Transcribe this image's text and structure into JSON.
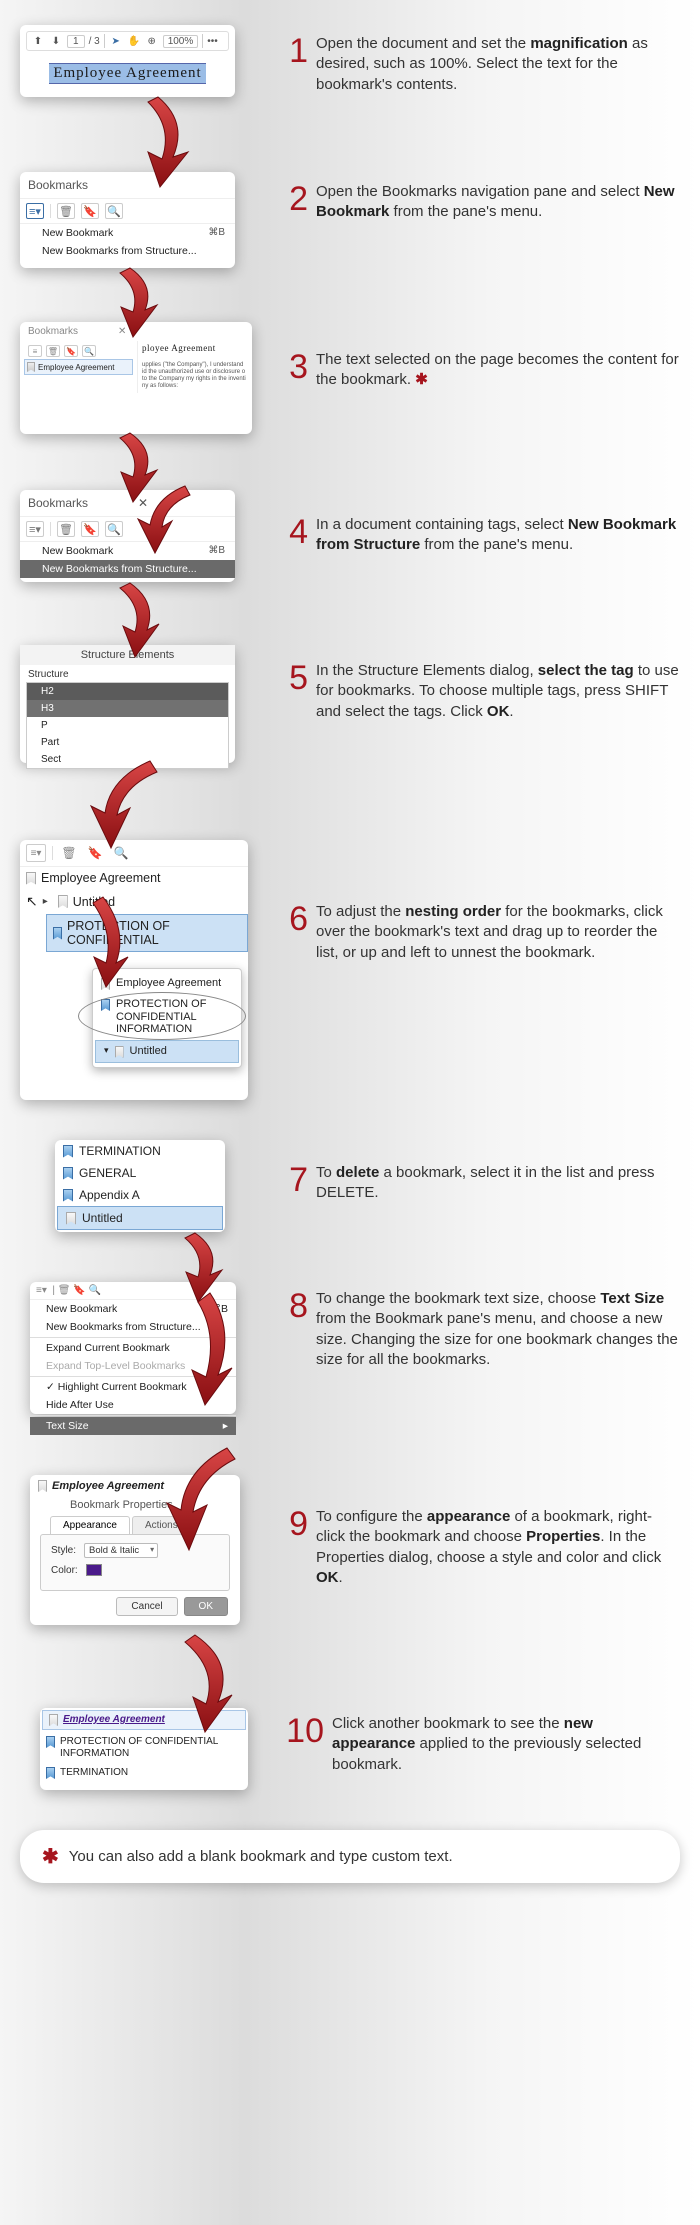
{
  "steps": {
    "s1a": "Open the document and set the ",
    "s1b": "magnification",
    "s1c": " as desired, such as 100%. Select the text for the bookmark's contents.",
    "s2a": "Open the Bookmarks navigation pane and select ",
    "s2b": "New Bookmark",
    "s2c": " from the pane's menu.",
    "s3a": "The text selected on the page becomes the content for the bookmark. ",
    "s4a": "In a document containing tags, select ",
    "s4b": "New Bookmark from Structure",
    "s4c": " from the pane's menu.",
    "s5a": "In the Structure Elements dialog, ",
    "s5b": "select the tag",
    "s5c": " to use for bookmarks. To choose multiple tags, press SHIFT and select the tags. Click ",
    "s5d": "OK",
    "s5e": ".",
    "s6a": "To adjust the ",
    "s6b": "nesting order",
    "s6c": " for the bookmarks, click over the bookmark's text and drag up to reorder the list, or up and left to unnest the bookmark.",
    "s7a": "To ",
    "s7b": "delete",
    "s7c": " a bookmark, select it in the list and press DELETE.",
    "s8a": "To change the bookmark text size, choose ",
    "s8b": "Text Size",
    "s8c": " from the Bookmark pane's menu, and choose a new size. Changing the size for one bookmark changes the size for all the bookmarks.",
    "s9a": "To configure the ",
    "s9b": "appearance",
    "s9c": " of a bookmark, right-click the bookmark and choose ",
    "s9d": "Properties",
    "s9e": ". In the Properties dialog, choose a style and color and click ",
    "s9f": "OK",
    "s9g": ".",
    "s10a": "Click another bookmark to see the ",
    "s10b": "new appearance",
    "s10c": " applied to the previously selected bookmark."
  },
  "nums": {
    "n1": "1",
    "n2": "2",
    "n3": "3",
    "n4": "4",
    "n5": "5",
    "n6": "6",
    "n7": "7",
    "n8": "8",
    "n9": "9",
    "n10": "10"
  },
  "asterisk": "✱",
  "footnote": "You can also add a blank bookmark and type custom text.",
  "p1": {
    "page_cur": "1",
    "page_sep": "/ 3",
    "zoom": "100%",
    "dots": "•••",
    "selected": "Employee  Agreement"
  },
  "p2": {
    "title": "Bookmarks",
    "new_bm": "New Bookmark",
    "shortcut": "⌘B",
    "new_struct": "New Bookmarks from Structure..."
  },
  "p3": {
    "title": "Bookmarks",
    "close": "✕",
    "bm_name": "Employee Agreement",
    "doc_title": "ployee  Agreement",
    "doc_body": "upplies (\"the Company\"), I understand\nid the unauthorized use or disclosure o\nto the Company my rights in the inventi\nny as follows:"
  },
  "p4": {
    "title": "Bookmarks",
    "close": "✕",
    "new_bm": "New Bookmark",
    "shortcut": "⌘B",
    "new_struct": "New Bookmarks from Structure..."
  },
  "p5": {
    "title": "Structure Elements",
    "label": "Structure",
    "tags": [
      "H2",
      "H3",
      "P",
      "Part",
      "Sect"
    ]
  },
  "p6": {
    "bm1": "Employee Agreement",
    "bm2": "Untitled",
    "bm3": "PROTECTION OF CONFIDENTIAL",
    "pop1": "Employee Agreement",
    "pop2": "PROTECTION OF CONFIDENTIAL INFORMATION",
    "bm4": "Untitled"
  },
  "p7": {
    "r1": "TERMINATION",
    "r2": "GENERAL",
    "r3": "Appendix A",
    "r4": "Untitled"
  },
  "p8": {
    "m1": "New Bookmark",
    "m1s": "⌘B",
    "m2": "New Bookmarks from Structure...",
    "m3": "Expand Current Bookmark",
    "m4": "Expand Top-Level Bookmarks",
    "m5": "Highlight Current Bookmark",
    "m6": "Hide After Use",
    "m7": "Text Size",
    "arrow": "▸"
  },
  "p9": {
    "bm": "Employee Agreement",
    "dlg": "Bookmark Properties",
    "tab1": "Appearance",
    "tab2": "Actions",
    "style_lbl": "Style:",
    "style_val": "Bold & Italic",
    "color_lbl": "Color:",
    "cancel": "Cancel",
    "ok": "OK"
  },
  "p10": {
    "r1": "Employee Agreement",
    "r2": "PROTECTION OF CONFIDENTIAL INFORMATION",
    "r3": "TERMINATION"
  }
}
